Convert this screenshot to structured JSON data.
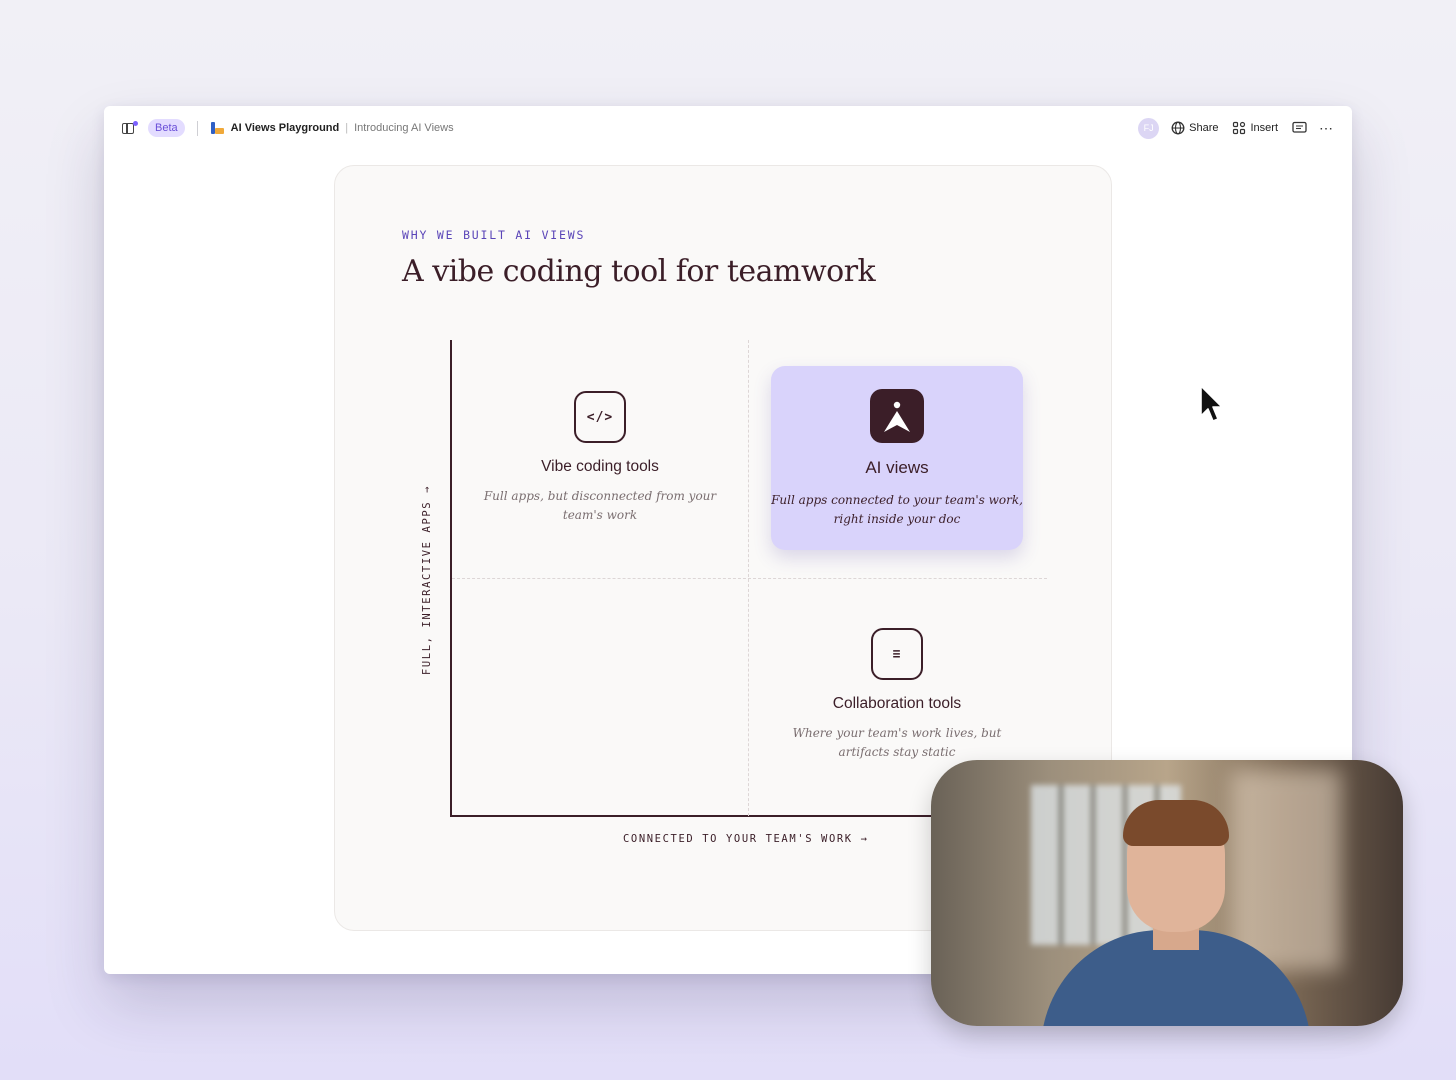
{
  "toolbar": {
    "beta_label": "Beta",
    "doc_title": "AI Views Playground",
    "page_name": "Introducing AI Views",
    "avatar_initials": "FJ",
    "share_label": "Share",
    "insert_label": "Insert",
    "more_label": "⋯"
  },
  "content": {
    "eyebrow": "WHY WE BUILT AI VIEWS",
    "headline": "A vibe coding tool for teamwork",
    "y_axis_label": "FULL, INTERACTIVE APPS →",
    "x_axis_label": "CONNECTED TO YOUR TEAM'S WORK →",
    "quadrants": [
      {
        "title": "Vibe coding tools",
        "description": "Full apps, but disconnected from your team's work",
        "icon": "code-icon",
        "icon_glyph": "</>"
      },
      {
        "title": "AI views",
        "description": "Full apps connected to your team's work, right inside your doc",
        "icon": "ai-views-logo-icon"
      },
      {
        "title": "Collaboration tools",
        "description": "Where your team's work lives, but artifacts stay static",
        "icon": "document-icon",
        "icon_glyph": "≡"
      }
    ]
  },
  "colors": {
    "accent": "#7b61ff",
    "highlight_card": "#d9d3fb",
    "ink": "#3b1e28",
    "eyebrow": "#5a45b8"
  }
}
